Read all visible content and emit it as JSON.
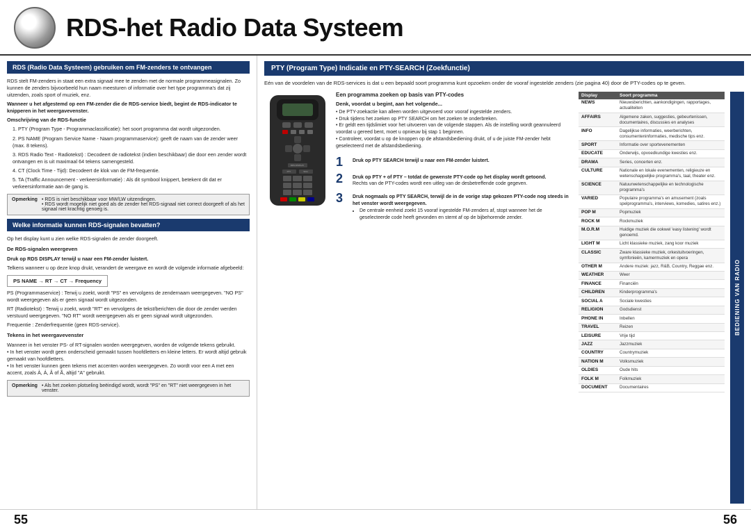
{
  "header": {
    "title": "RDS-het Radio Data Systeem"
  },
  "left": {
    "section1_title": "RDS (Radio Data Systeem) gebruiken om FM-zenders te ontvangen",
    "section1_intro": "RDS stelt FM-zenders in staat een extra signaal mee te zenden met de normale programmeasignalen. Zo kunnen de zenders bijvoorbeeld hun naam meesturen of informatie over het type programma's dat zij uitzenden, zoals sport of muziek, enz.",
    "section1_highlight": "Wanneer u het afgestemd op een FM-zender die de RDS-service biedt, begint de RDS-indicator te knipperen in het weergavevenster.",
    "section1_omschrijving": "Omschrijving van de RDS-functie",
    "section1_items": [
      "1. PTY (Program Type - Programmaclassificatie): het soort programma dat wordt uitgezonden.",
      "2. PS NAME (Program Service Name - Naam programmaservice): geeft de naam van de zender weer (max. 8 tekens).",
      "3. RDS Radio Text - Radiotekst) : Decodeert de radiotekst (indien beschikbaar) die door een zender wordt ontvangen en is uit maximaal 64 tekens samengesteld.",
      "4. CT (Clock Time - Tijd): Decodeert de klok van de FM-frequentie.",
      "5. TA (Traffic Announcement - verkeersinformatie) : Als dit symbool knippert, betekent dit dat er verkeersinformatie aan de gang is."
    ],
    "note1_label": "Opmerking",
    "note1_text": "• RDS is niet beschikbaar voor MW/LW uitzendingen.\n• RDS wordt mogelijk niet goed als de zender het RDS-signaal niet correct doorgeeft of als het signaal niet krachtig genoeg is.",
    "section2_title": "Welke informatie kunnen RDS-signalen bevatten?",
    "section2_intro": "Op het display kunt u zien welke RDS-signalen de zender doorgeeft.",
    "section2_subtitle": "De RDS-signalen weergeven",
    "section2_instruction": "Druk op RDS DISPLAY terwijl u naar een FM-zender luistert.",
    "section2_instruction2": "Telkens wanneer u op deze knop drukt, verandert de weergave en wordt de volgende informatie afgebeeld:",
    "flow": "PS NAME → RT → CT → Frequency",
    "section2_ps": "PS (Programmaservice) : Terwij u zoekt, wordt \"PS\" en vervolgens de zendernaam weergegeven. \"NO PS\" wordt weergegeven als er geen signaal wordt uitgezonden.",
    "section2_rt": "RT (Radiotekst) : Terwij u zoekt, wordt \"RT\" en vervolgens de tekst/berichten die door de zender werden verstuurd weergegeven. \"NO RT\" wordt weergegeven als er geen signaal wordt uitgezonden.",
    "section2_freq": "Frequentie : Zenderfrequentie (geen RDS-service).",
    "section2_tokens_title": "Tekens in het weergavevenster",
    "section2_tokens_text": "Wanneer in het venster PS- of RT-signalen worden weergegeven, worden de volgende tekens gebruikt.\n• In het venster wordt geen onderscheid gemaakt tussen hoofdletters en kleine letters. Er wordt altijd gebruik gemaakt van hoofdletters.\n• In het venster kunnen geen tekens met accenten worden weergegeven. Zo wordt voor een A met een accent, zoals À, Á, Â of Ã, altijd \"A\" gebruikt.",
    "note2_label": "Opmerking",
    "note2_text": "• Als het zoeken plotseling beëindigd wordt, wordt \"PS\" en \"RT\" niet weergegeven in het venster."
  },
  "right": {
    "section_title": "PTY (Program Type) Indicatie en PTY-SEARCH (Zoekfunctie)",
    "top_desc": "Eén van de voordelen van de RDS-services is dat u een bepaald soort programma kunt opzoeken onder de vooraf ingestelde zenders (zie pagina 40) door de PTY-codes op te geven.",
    "pty_section_title": "Een programma zoeken op basis van PTY-codes",
    "steps_intro_title": "Denk, voordat u begint, aan het volgende...",
    "steps_intro_items": [
      "De PTY-zoekactie kan alleen worden uitgevoerd voor vooraf ingestelde zenders.",
      "Druk tijdens het zoeken op PTY SEARCH om het zoeken te onderbreken.",
      "Er geldt een tijdslimiet voor het uitvoeren van de volgende stappen. Als de instelling wordt geannuleerd voordat u gereed bent, moet u opnieuw bij stap 1 beginnen.",
      "Controleer, voordat u op de knoppen op de afstandsbediening drukt, of u de juiste FM-zender hebt geselecteerd met de afstandsbediening."
    ],
    "step1_num": "1",
    "step1_bold": "Druk op PTY SEARCH terwijl u naar een FM-zender luistert.",
    "step2_num": "2",
    "step2_bold": "Druk op PTY + of PTY – totdat de gewenste PTY-code op het display wordt getoond.",
    "step2_sub": "Rechts van de PTY-codes wordt een uitleg van de desbetreffende code gegeven.",
    "step3_num": "3",
    "step3_bold": "Druk nogmaals op PTY SEARCH, terwijl de in de vorige stap gekozen PTY-code nog steeds in het venster wordt weergegeven.",
    "step3_items": [
      "De centrale eenheid zoekt 15 vooraf ingestelde FM-zenders af, stopt wanneer het de geselecteerde code heeft gevonden en stemt af op de bijbehorende zender."
    ],
    "table_headers": {
      "display": "Display",
      "program": "Soort programma"
    },
    "table_rows": [
      {
        "display": "NEWS",
        "program": "Nieuwsberichten, aankondigingen, rapportages, actualiteiten"
      },
      {
        "display": "AFFAIRS",
        "program": "Algemene zaken, suggesties, gebeurtenissen, documentaires, discussies en analyses"
      },
      {
        "display": "INFO",
        "program": "Dagelijkse informaties, weerberichten, consumenteninformaties, medische tips enz."
      },
      {
        "display": "SPORT",
        "program": "Informatie over sportevenementen"
      },
      {
        "display": "EDUCATE",
        "program": "Onderwijs, opvoedkundige kwesties enz."
      },
      {
        "display": "DRAMA",
        "program": "Series, concerten enz."
      },
      {
        "display": "CULTURE",
        "program": "Nationale en lokale evenementen, religieuze en wetenschappelijke programma's, taal, theater enz."
      },
      {
        "display": "SCIENCE",
        "program": "Natuurwetenschappelijke en technologische programma's"
      },
      {
        "display": "VARIED",
        "program": "Populaire programma's en amusement (zoals spelprogramma's, interviews, komedies, satires enz.)"
      },
      {
        "display": "POP M",
        "program": "Popmuziek"
      },
      {
        "display": "ROCK M",
        "program": "Rockmuziek"
      },
      {
        "display": "M.O.R.M",
        "program": "Huidige muziek die ookwel 'easy listening' wordt genoemd."
      },
      {
        "display": "LIGHT M",
        "program": "Licht klassieke muziek, zang koor muziek"
      },
      {
        "display": "CLASSIC",
        "program": "Zware klassieke muziek, orkestuitvoeringen, symfonieën, kamermuziek en opera"
      },
      {
        "display": "OTHER M",
        "program": "Andere muziek: jazz, R&B, Country, Reggae enz."
      },
      {
        "display": "WEATHER",
        "program": "Weer"
      },
      {
        "display": "FINANCE",
        "program": "Financiën"
      },
      {
        "display": "CHILDREN",
        "program": "Kinderprogramma's"
      },
      {
        "display": "SOCIAL A",
        "program": "Sociale kwesties"
      },
      {
        "display": "RELIGION",
        "program": "Godsdienst"
      },
      {
        "display": "PHONE IN",
        "program": "Inbellen"
      },
      {
        "display": "TRAVEL",
        "program": "Reizen"
      },
      {
        "display": "LEISURE",
        "program": "Vrije tijd"
      },
      {
        "display": "JAZZ",
        "program": "Jazzmuziek"
      },
      {
        "display": "COUNTRY",
        "program": "Countrymuziek"
      },
      {
        "display": "NATION M",
        "program": "Volksmuziek"
      },
      {
        "display": "OLDIES",
        "program": "Oude hits"
      },
      {
        "display": "FOLK M",
        "program": "Folkmuziek"
      },
      {
        "display": "DOCUMENT",
        "program": "Documentaires"
      }
    ],
    "vertical_bar_text": "BEDIENING VAN RADIO"
  },
  "footer": {
    "page_left": "55",
    "page_right": "56"
  }
}
